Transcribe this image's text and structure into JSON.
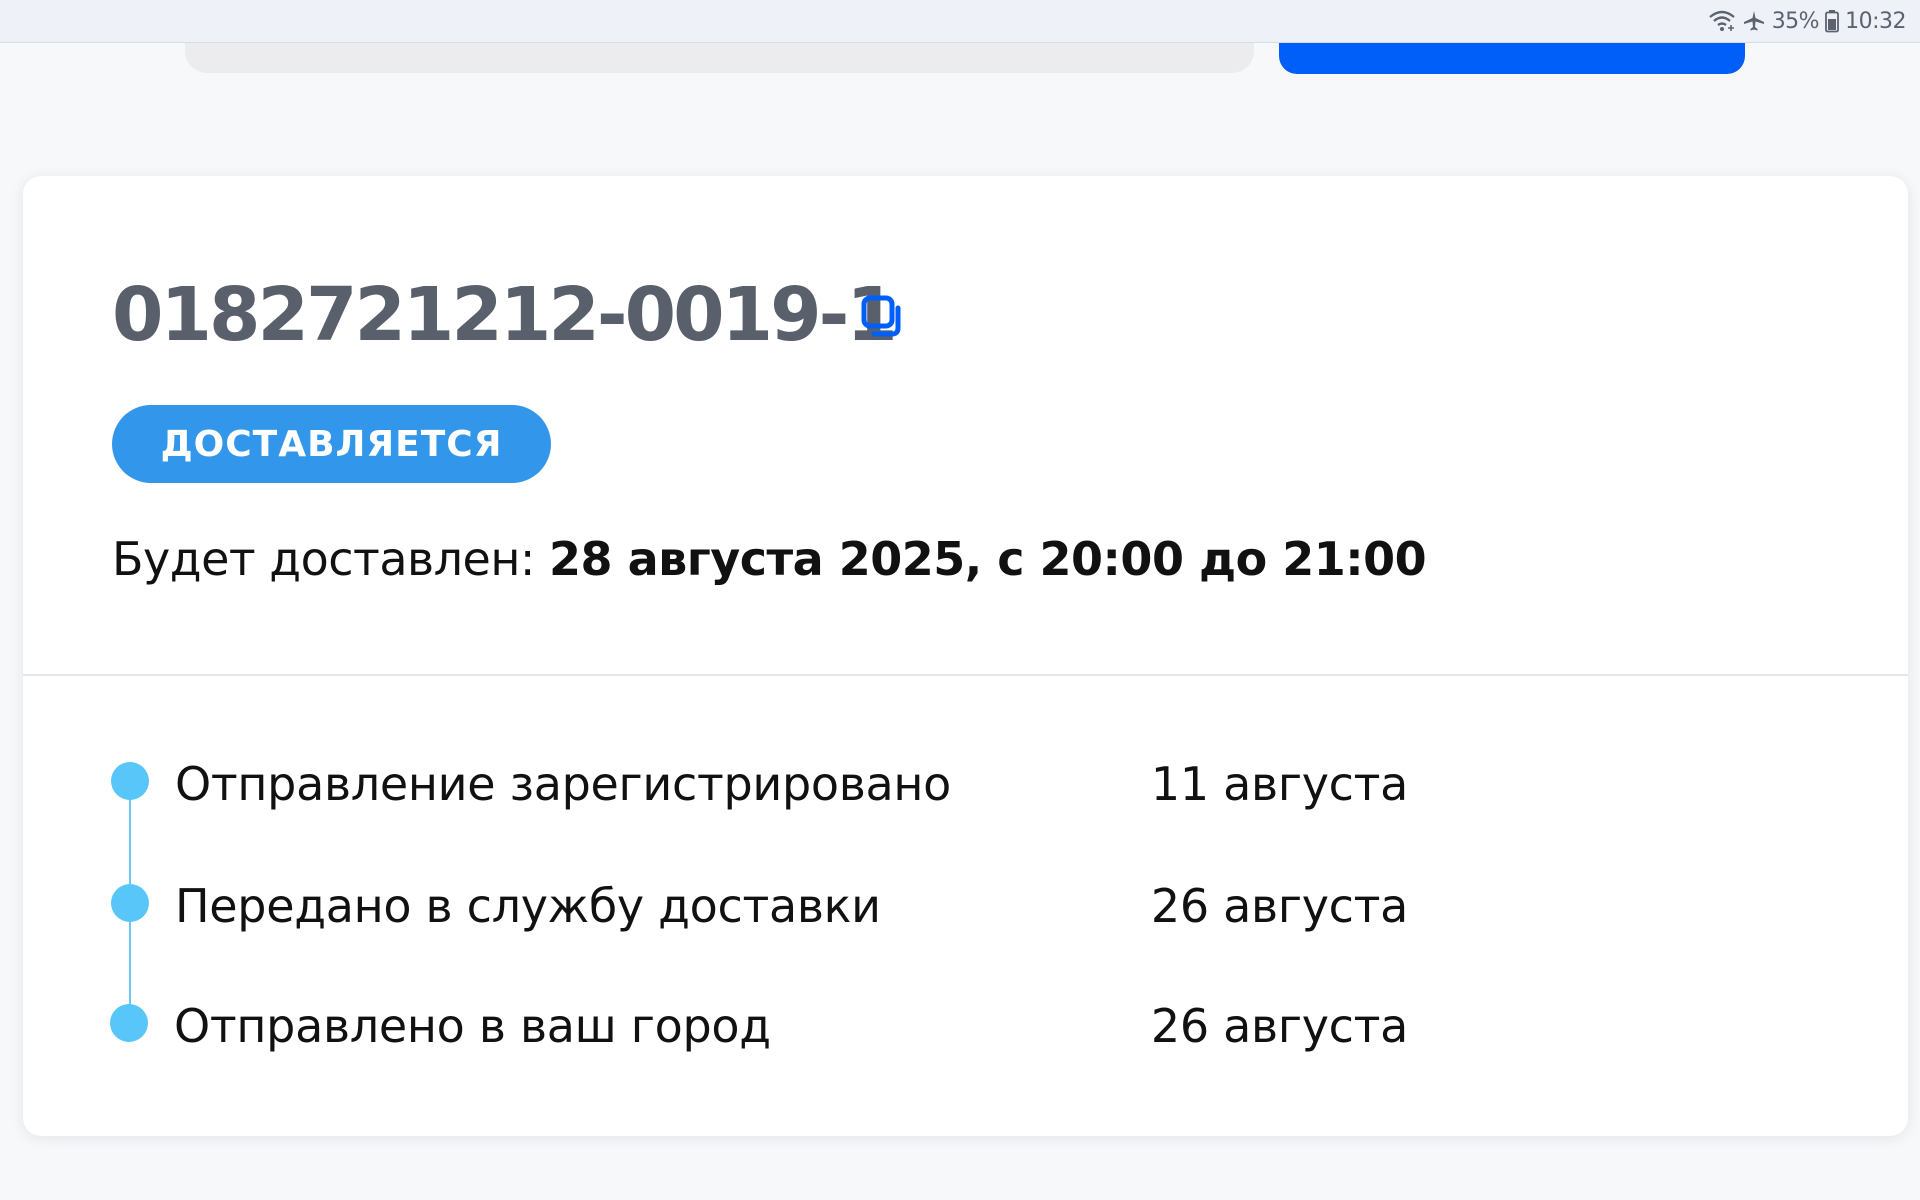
{
  "status_bar": {
    "battery": "35%",
    "time": "10:32",
    "icons": [
      "wifi-icon",
      "airplane-icon",
      "battery-icon"
    ]
  },
  "shipment": {
    "tracking_number": "0182721212-0019-1",
    "status_badge": "ДОСТАВЛЯЕТСЯ",
    "delivery_label": "Будет доставлен:",
    "delivery_value": "28 августа 2025, с 20:00 до 21:00"
  },
  "timeline": [
    {
      "label": "Отправление зарегистрировано",
      "date": "11 августа"
    },
    {
      "label": "Передано в службу доставки",
      "date": "26 августа"
    },
    {
      "label": "Отправлено в ваш город",
      "date": "26 августа"
    }
  ],
  "colors": {
    "accent_blue": "#005ff9",
    "badge_blue": "#3297ea",
    "timeline_blue": "#58c6f8",
    "tracking_gray": "#59606b"
  }
}
